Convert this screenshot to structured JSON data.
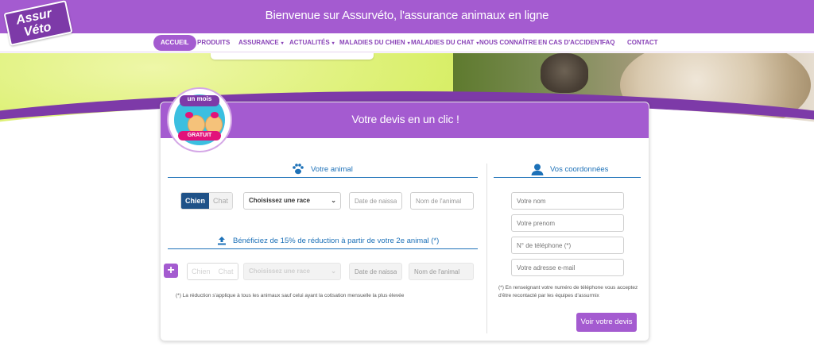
{
  "header": {
    "site_title": "Bienvenue sur Assurvéto, l'assurance animaux en ligne",
    "logo_line1": "Assur",
    "logo_line2": "Véto"
  },
  "nav": {
    "items": [
      {
        "label": "ACCUEIL",
        "active": true
      },
      {
        "label": "PRODUITS"
      },
      {
        "label": "ASSURANCE",
        "dropdown": true
      },
      {
        "label": "ACTUALITÉS",
        "dropdown": true
      },
      {
        "label": "MALADIES DU CHIEN",
        "dropdown": true
      },
      {
        "label": "MALADIES DU CHAT",
        "dropdown": true
      },
      {
        "label": "NOUS CONNAÎTRE"
      },
      {
        "label": "EN CAS D'ACCIDENT"
      },
      {
        "label": "FAQ"
      },
      {
        "label": "CONTACT"
      }
    ],
    "caret": "▾"
  },
  "badge": {
    "top": "un mois",
    "bottom": "GRATUIT"
  },
  "quote": {
    "title": "Votre devis en un clic !",
    "animal_section": "Votre animal",
    "toggle_dog": "Chien",
    "toggle_cat": "Chat",
    "breed_select": "Choisissez une race",
    "birth_placeholder": "Date de naissan",
    "name_placeholder": "Nom de l'animal",
    "second_animal_section": "Bénéficiez de 15% de réduction à partir de votre 2e animal (*)",
    "plus_label": "+",
    "discount_note": "(*) La réduction s'applique à tous les animaux sauf celui ayant la cotisation mensuelle la plus élevée",
    "chevron": "⌄"
  },
  "contact": {
    "section": "Vos coordonnées",
    "name_placeholder": "Votre nom",
    "firstname_placeholder": "Votre prenom",
    "phone_placeholder": "N° de téléphone (*)",
    "email_placeholder": "Votre adresse e-mail",
    "note_line1": "(*) En renseignant votre numéro de téléphone vous acceptez",
    "note_line2": "d'être recontacté par les équipes d'assurmix",
    "submit": "Voir votre devis"
  },
  "colors": {
    "primary": "#a45bd0",
    "accent_blue": "#1d71b8",
    "toggle_active": "#1f5288"
  },
  "icons": {
    "paw": "paw-icon",
    "user": "user-icon",
    "upload": "upload-icon",
    "plus": "plus-icon"
  }
}
